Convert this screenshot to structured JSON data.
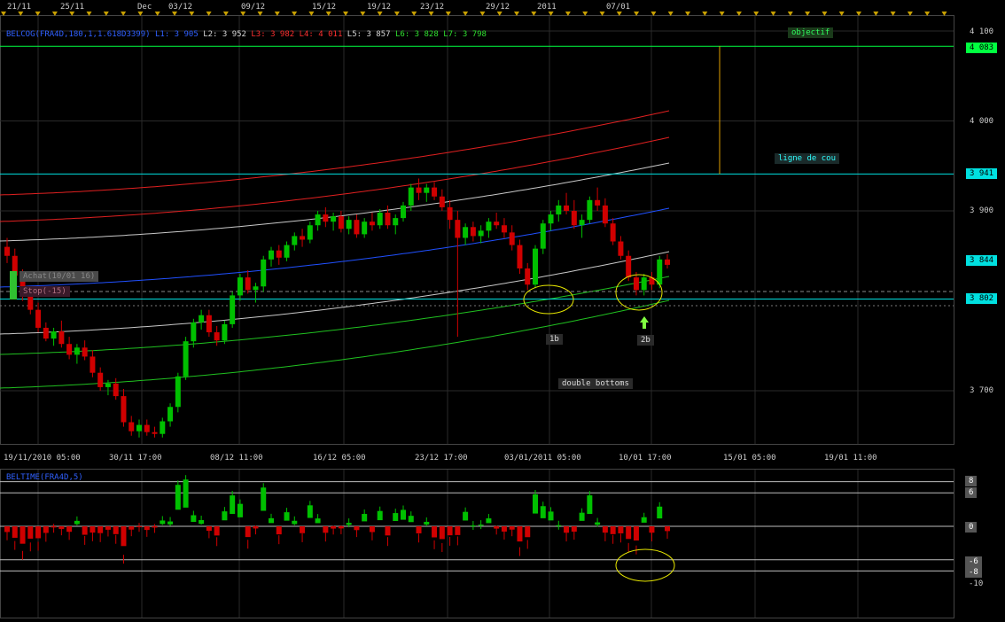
{
  "colors": {
    "background": "#000000",
    "grid": "#2a2a2a",
    "up_candle": "#00c000",
    "down_candle": "#d00000",
    "band_red": "#e02020",
    "band_white": "#c8c8c8",
    "band_blue": "#2050ff",
    "band_green": "#20c020",
    "objective_line": "#00ff40",
    "cyan_line": "#00e0e0",
    "vertical_marker": "#e0a000",
    "annotation_ellipse": "#e8e800"
  },
  "top_axis": {
    "labels": [
      "21/11",
      "25/11",
      "Dec",
      "03/12",
      "09/12",
      "15/12",
      "19/12",
      "23/12",
      "29/12",
      "2011",
      "07/01"
    ]
  },
  "main_chart": {
    "indicator_header": {
      "name": "BELCOG(FRA4D,180,1,1.618D3399)",
      "l1": "L1: 3 905",
      "l2": "L2: 3 952",
      "l3": "L3: 3 982",
      "l4": "L4: 4 011",
      "l5": "L5: 3 857",
      "l6": "L6: 3 828",
      "l7": "L7: 3 798"
    },
    "price_axis": {
      "ticks": [
        "4 100",
        "4 000",
        "3 900",
        "3 700"
      ],
      "highlighted": [
        {
          "label": "4 083",
          "color": "#00ff40"
        },
        {
          "label": "3 941",
          "color": "#00e0e0"
        },
        {
          "label": "3 844",
          "color": "#00e0e0"
        },
        {
          "label": "3 802",
          "color": "#00e0e0"
        }
      ]
    },
    "date_axis": [
      "19/11/2010 05:00",
      "30/11 17:00",
      "08/12 11:00",
      "16/12 05:00",
      "23/12 17:00",
      "03/01/2011 05:00",
      "10/01 17:00",
      "15/01 05:00",
      "19/01 11:00"
    ],
    "labels": {
      "objective": "objectif",
      "neckline": "ligne de cou",
      "bottom1": "1b",
      "bottom2": "2b",
      "double_bottoms": "double bottoms",
      "buy": "Achat(10/01 16)",
      "stop": "Stop(-15)"
    }
  },
  "oscillator": {
    "name": "BELTIME(FRA4D,5)",
    "axis_ticks": [
      "8",
      "6",
      "0",
      "-6",
      "-8",
      "-10"
    ]
  },
  "chart_data": {
    "type": "candlestick",
    "y_axis_ticks": [
      4100,
      4000,
      3900,
      3700
    ],
    "horizontal_levels": {
      "objective": 4083,
      "neckline": 3941,
      "last": 3844,
      "support": 3802
    },
    "candles": [
      [
        3860,
        3870,
        3842,
        3850
      ],
      [
        3850,
        3858,
        3820,
        3828
      ],
      [
        3828,
        3835,
        3800,
        3806
      ],
      [
        3806,
        3812,
        3785,
        3790
      ],
      [
        3790,
        3798,
        3765,
        3770
      ],
      [
        3770,
        3776,
        3755,
        3758
      ],
      [
        3758,
        3770,
        3750,
        3766
      ],
      [
        3766,
        3778,
        3748,
        3752
      ],
      [
        3752,
        3760,
        3735,
        3740
      ],
      [
        3740,
        3752,
        3730,
        3748
      ],
      [
        3748,
        3756,
        3734,
        3738
      ],
      [
        3738,
        3745,
        3715,
        3720
      ],
      [
        3720,
        3726,
        3700,
        3704
      ],
      [
        3704,
        3712,
        3695,
        3708
      ],
      [
        3708,
        3714,
        3690,
        3694
      ],
      [
        3694,
        3702,
        3660,
        3665
      ],
      [
        3665,
        3672,
        3650,
        3655
      ],
      [
        3655,
        3668,
        3648,
        3662
      ],
      [
        3662,
        3668,
        3650,
        3654
      ],
      [
        3654,
        3660,
        3648,
        3652
      ],
      [
        3652,
        3670,
        3648,
        3666
      ],
      [
        3666,
        3686,
        3660,
        3682
      ],
      [
        3682,
        3720,
        3676,
        3716
      ],
      [
        3716,
        3760,
        3712,
        3755
      ],
      [
        3755,
        3780,
        3748,
        3776
      ],
      [
        3776,
        3790,
        3768,
        3784
      ],
      [
        3784,
        3790,
        3760,
        3765
      ],
      [
        3765,
        3772,
        3750,
        3756
      ],
      [
        3756,
        3778,
        3752,
        3774
      ],
      [
        3774,
        3810,
        3770,
        3806
      ],
      [
        3806,
        3830,
        3800,
        3826
      ],
      [
        3826,
        3834,
        3808,
        3812
      ],
      [
        3812,
        3820,
        3798,
        3816
      ],
      [
        3816,
        3850,
        3810,
        3846
      ],
      [
        3846,
        3860,
        3838,
        3856
      ],
      [
        3856,
        3862,
        3840,
        3848
      ],
      [
        3848,
        3866,
        3844,
        3862
      ],
      [
        3862,
        3876,
        3856,
        3872
      ],
      [
        3872,
        3880,
        3860,
        3868
      ],
      [
        3868,
        3888,
        3864,
        3884
      ],
      [
        3884,
        3900,
        3878,
        3896
      ],
      [
        3896,
        3904,
        3882,
        3888
      ],
      [
        3888,
        3898,
        3878,
        3894
      ],
      [
        3894,
        3900,
        3876,
        3880
      ],
      [
        3880,
        3894,
        3874,
        3890
      ],
      [
        3890,
        3896,
        3870,
        3874
      ],
      [
        3874,
        3892,
        3870,
        3888
      ],
      [
        3888,
        3898,
        3878,
        3884
      ],
      [
        3884,
        3902,
        3880,
        3898
      ],
      [
        3898,
        3906,
        3880,
        3884
      ],
      [
        3884,
        3896,
        3874,
        3892
      ],
      [
        3892,
        3910,
        3888,
        3906
      ],
      [
        3906,
        3930,
        3900,
        3926
      ],
      [
        3926,
        3936,
        3912,
        3920
      ],
      [
        3920,
        3930,
        3910,
        3926
      ],
      [
        3926,
        3932,
        3912,
        3916
      ],
      [
        3916,
        3924,
        3900,
        3904
      ],
      [
        3904,
        3912,
        3880,
        3890
      ],
      [
        3890,
        3900,
        3760,
        3870
      ],
      [
        3870,
        3886,
        3862,
        3882
      ],
      [
        3882,
        3888,
        3866,
        3872
      ],
      [
        3872,
        3884,
        3864,
        3878
      ],
      [
        3878,
        3892,
        3870,
        3888
      ],
      [
        3888,
        3898,
        3880,
        3884
      ],
      [
        3884,
        3892,
        3870,
        3876
      ],
      [
        3876,
        3884,
        3856,
        3862
      ],
      [
        3862,
        3868,
        3830,
        3836
      ],
      [
        3836,
        3842,
        3812,
        3818
      ],
      [
        3818,
        3862,
        3814,
        3858
      ],
      [
        3858,
        3890,
        3852,
        3886
      ],
      [
        3886,
        3900,
        3878,
        3896
      ],
      [
        3896,
        3912,
        3888,
        3906
      ],
      [
        3906,
        3920,
        3896,
        3900
      ],
      [
        3900,
        3912,
        3880,
        3884
      ],
      [
        3884,
        3896,
        3870,
        3890
      ],
      [
        3890,
        3916,
        3886,
        3912
      ],
      [
        3912,
        3926,
        3900,
        3906
      ],
      [
        3906,
        3914,
        3882,
        3886
      ],
      [
        3886,
        3892,
        3862,
        3866
      ],
      [
        3866,
        3872,
        3846,
        3850
      ],
      [
        3850,
        3856,
        3822,
        3826
      ],
      [
        3826,
        3832,
        3806,
        3812
      ],
      [
        3812,
        3830,
        3806,
        3826
      ],
      [
        3826,
        3832,
        3812,
        3818
      ],
      [
        3818,
        3850,
        3814,
        3846
      ],
      [
        3846,
        3852,
        3836,
        3840
      ]
    ]
  }
}
